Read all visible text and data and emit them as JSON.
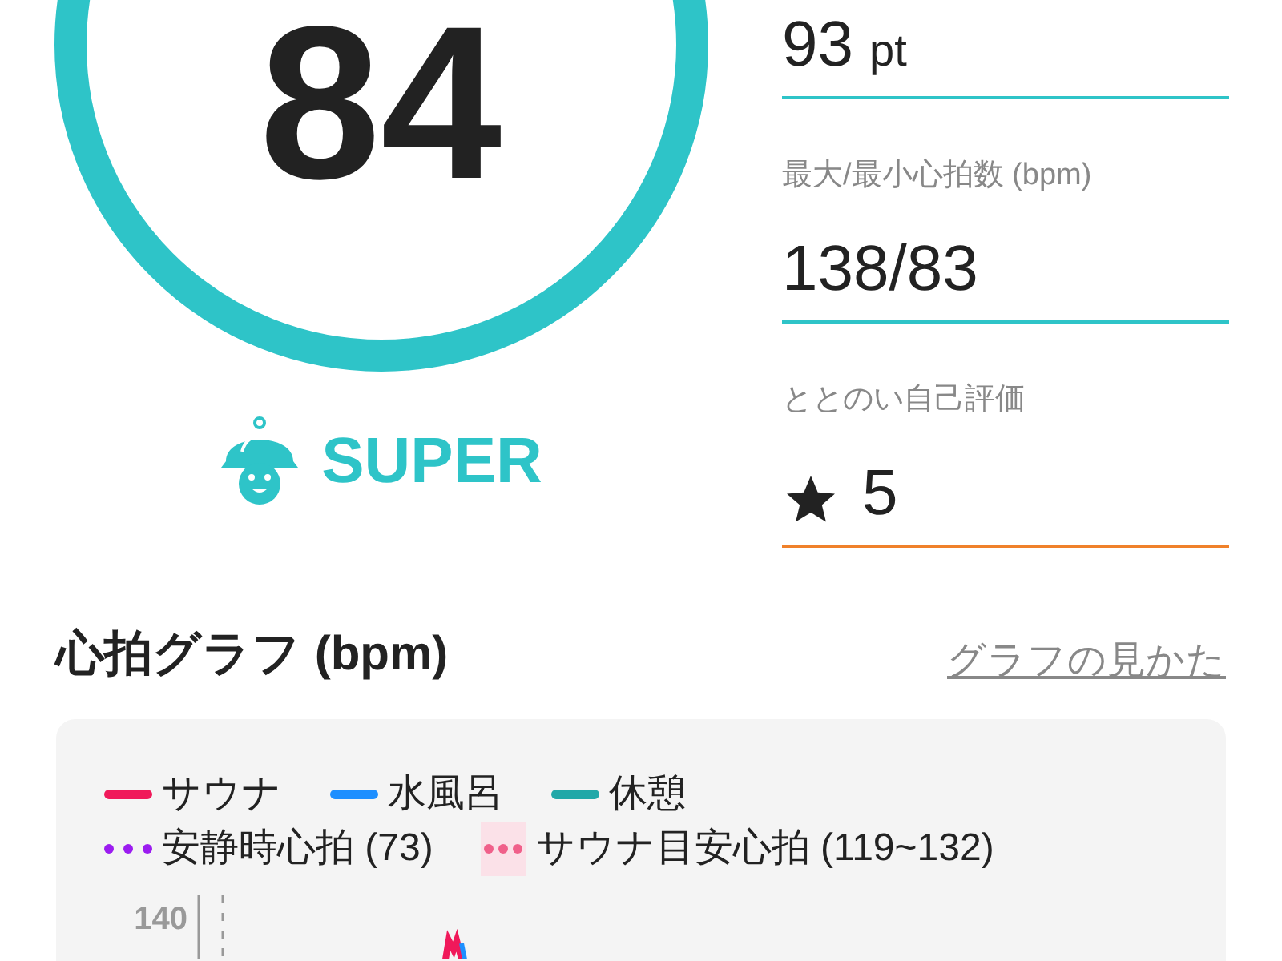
{
  "score": {
    "value": "84",
    "rank": "SUPER"
  },
  "metrics": [
    {
      "value": "93",
      "unit": "pt",
      "kind": "plain",
      "color": "#2ec4c8"
    },
    {
      "label": "最大/最小心拍数 (bpm)",
      "value": "138/83",
      "kind": "plain",
      "color": "#2ec4c8"
    },
    {
      "label": "ととのい自己評価",
      "value": "5",
      "kind": "rating",
      "color": "#f0812a"
    }
  ],
  "heart_graph": {
    "title": "心拍グラフ (bpm)",
    "help_link": "グラフの見かた",
    "legend": [
      {
        "label": "サウナ",
        "kind": "solid",
        "color": "#f0195a"
      },
      {
        "label": "水風呂",
        "kind": "solid",
        "color": "#1e8fff"
      },
      {
        "label": "休憩",
        "kind": "solid",
        "color": "#21a8a8"
      },
      {
        "label": "安静時心拍 (73)",
        "kind": "dotted",
        "color": "#9b1cf0"
      },
      {
        "label": "サウナ目安心拍 (119~132)",
        "kind": "band",
        "color": "#f0608a"
      }
    ],
    "y_tick": "140"
  }
}
